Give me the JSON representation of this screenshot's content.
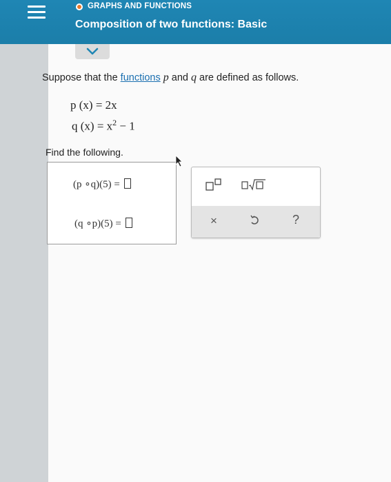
{
  "header": {
    "topic": "GRAPHS AND FUNCTIONS",
    "title": "Composition of two functions: Basic"
  },
  "problem": {
    "intro_before": "Suppose that the ",
    "intro_link": "functions",
    "var_p": "p",
    "intro_and": " and ",
    "var_q": "q",
    "intro_after": " are defined as follows.",
    "eq1": "p (x) = 2x",
    "eq2_start": "q (x) = x",
    "eq2_exp": "2",
    "eq2_end": " − 1",
    "find": "Find the following.",
    "comp1": "(p ∘q)(5) =",
    "comp2": "(q ∘p)(5) ="
  },
  "toolbar": {
    "times": "×",
    "help": "?"
  },
  "icons": [
    "menu-icon",
    "chevron-down-icon",
    "exponent-icon",
    "square-root-icon",
    "undo-icon",
    "help-icon"
  ],
  "colors": {
    "header": "#1f86b4",
    "link": "#1a6fb0",
    "topic_dot": "#e9782b"
  }
}
